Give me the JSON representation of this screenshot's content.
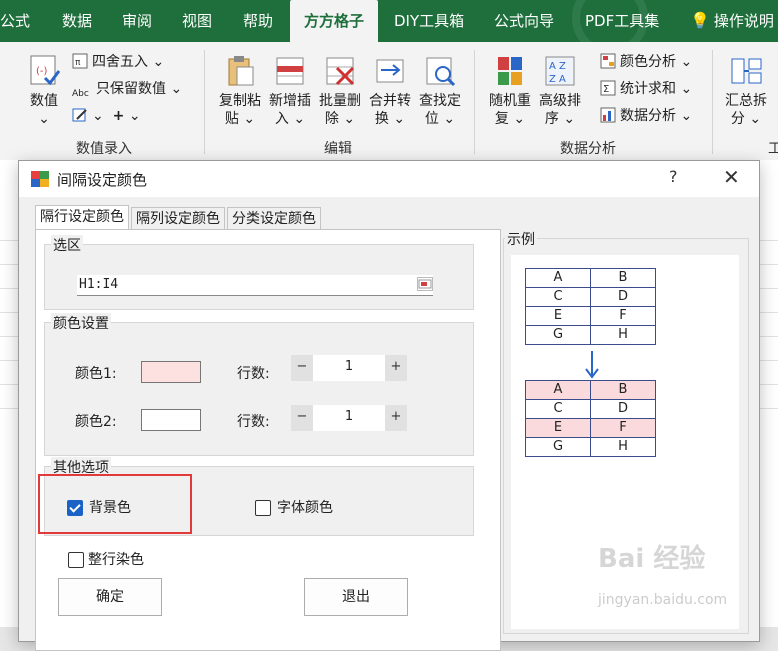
{
  "ribbon_tabs": [
    "公式",
    "数据",
    "审阅",
    "视图",
    "帮助",
    "方方格子",
    "DIY工具箱",
    "公式向导",
    "PDF工具集"
  ],
  "active_tab": "方方格子",
  "tell_me": "操作说明",
  "ribbon": {
    "shuzhi": {
      "line1": "数值",
      "line2": "⌄"
    },
    "round": "四舍五入",
    "keep_value": "只保留数值",
    "group_input": "数值录入",
    "copy_paste": {
      "line1": "复制粘",
      "line2": "贴 ⌄"
    },
    "insert": {
      "line1": "新增插",
      "line2": "入 ⌄"
    },
    "batch_delete": {
      "line1": "批量删",
      "line2": "除 ⌄"
    },
    "merge": {
      "line1": "合并转",
      "line2": "换 ⌄"
    },
    "find": {
      "line1": "查找定",
      "line2": "位 ⌄"
    },
    "group_edit": "编辑",
    "random": {
      "line1": "随机重",
      "line2": "复 ⌄"
    },
    "sort": {
      "line1": "高级排",
      "line2": "序 ⌄"
    },
    "color_analysis": "颜色分析 ⌄",
    "stat_sum": "统计求和 ⌄",
    "data_analysis": "数据分析 ⌄",
    "group_analysis": "数据分析",
    "summary": {
      "line1": "汇总拆",
      "line2": "分 ⌄"
    },
    "tools_cut": "工"
  },
  "dialog": {
    "title": "间隔设定颜色",
    "help": "?",
    "close": "✕",
    "tabs": [
      "隔行设定颜色",
      "隔列设定颜色",
      "分类设定颜色"
    ],
    "range_legend": "选区",
    "range_value": "H1:I4",
    "color_legend": "颜色设置",
    "color1_label": "颜色1:",
    "color2_label": "颜色2:",
    "rows_label": "行数:",
    "row1_value": "1",
    "row2_value": "1",
    "minus": "−",
    "plus": "+",
    "color1": "#fde0e0",
    "color2": "#ffffff",
    "other_legend": "其他选项",
    "bg_color_label": "背景色",
    "bg_color_checked": true,
    "font_color_label": "字体颜色",
    "font_color_checked": false,
    "whole_row_label": "整行染色",
    "whole_row_checked": false,
    "ok": "确定",
    "exit": "退出",
    "example_legend": "示例",
    "example_before": [
      [
        "A",
        "B"
      ],
      [
        "C",
        "D"
      ],
      [
        "E",
        "F"
      ],
      [
        "G",
        "H"
      ]
    ],
    "example_after": [
      [
        "A",
        "B"
      ],
      [
        "C",
        "D"
      ],
      [
        "E",
        "F"
      ],
      [
        "G",
        "H"
      ]
    ]
  },
  "watermark": {
    "line1": "Bai 经验",
    "line2": "jingyan.baidu.com"
  }
}
